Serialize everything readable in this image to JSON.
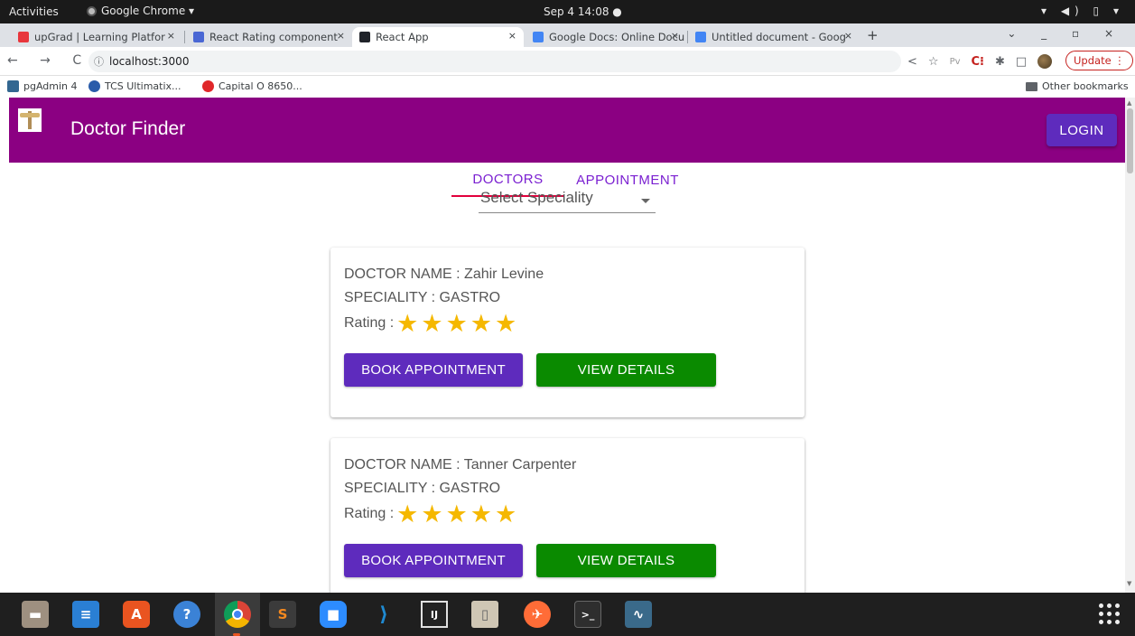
{
  "system": {
    "activities": "Activities",
    "app_name": "Google Chrome ▾",
    "clock": "Sep 4  14:08  ●",
    "tray": "▾ ◀) ▯ ▾"
  },
  "browser": {
    "tabs": [
      {
        "label": "upGrad | Learning Platfor",
        "color": "#e8363c"
      },
      {
        "label": "React Rating component",
        "color": "#4a67d4"
      },
      {
        "label": "React App",
        "color": "#20232a"
      },
      {
        "label": "Google Docs: Online Docu",
        "color": "#4285f4"
      },
      {
        "label": "Untitled document - Goog",
        "color": "#4285f4"
      }
    ],
    "tab_close": "×",
    "new_tab": "+",
    "window_controls": "⌄ _ ▫ ×",
    "nav_buttons": "← → C",
    "url": "localhost:3000",
    "update_label": "Update ⋮",
    "bookmarks": [
      {
        "label": "pgAdmin 4",
        "color": "#336791"
      },
      {
        "label": "TCS Ultimatix...",
        "color": "#2a5caa"
      },
      {
        "label": "Capital O 8650...",
        "color": "#e0272a"
      }
    ],
    "other_bookmarks": "Other bookmarks"
  },
  "app": {
    "title": "Doctor Finder",
    "login_label": "LOGIN",
    "tabs": [
      "DOCTORS",
      "APPOINTMENT"
    ],
    "select_placeholder": "Select Speciality",
    "doctors": [
      {
        "name_line": "DOCTOR NAME : Zahir Levine",
        "speciality_line": "SPECIALITY : GASTRO",
        "rating_label": "Rating :",
        "rating": 5,
        "book_label": "BOOK APPOINTMENT",
        "view_label": "VIEW DETAILS"
      },
      {
        "name_line": "DOCTOR NAME : Tanner Carpenter",
        "speciality_line": "SPECIALITY : GASTRO",
        "rating_label": "Rating :",
        "rating": 5,
        "book_label": "BOOK APPOINTMENT",
        "view_label": "VIEW DETAILS"
      }
    ]
  },
  "colors": {
    "header": "#8b0082",
    "primary_button": "#5e2bbd",
    "details_button": "#0a8a00",
    "star": "#f5b800",
    "tab_text": "#7a1fd1",
    "tab_indicator": "#e2003c"
  },
  "dock": {
    "apps": [
      {
        "name": "files-icon",
        "glyph": "▬",
        "color": "#9e9080"
      },
      {
        "name": "writer-icon",
        "glyph": "≡",
        "color": "#2a7fd4"
      },
      {
        "name": "software-icon",
        "glyph": "A",
        "color": "#e95420"
      },
      {
        "name": "help-icon",
        "glyph": "?",
        "color": "#3b82d6"
      },
      {
        "name": "chrome-icon",
        "glyph": "◉",
        "color": "#db4437"
      },
      {
        "name": "sublime-icon",
        "glyph": "S",
        "color": "#f5891f"
      },
      {
        "name": "zoom-icon",
        "glyph": "■",
        "color": "#2d8cff"
      },
      {
        "name": "vscode-icon",
        "glyph": "⟩",
        "color": "#1f8ad2"
      },
      {
        "name": "intellij-icon",
        "glyph": "IJ",
        "color": "#222222"
      },
      {
        "name": "archive-icon",
        "glyph": "▯",
        "color": "#cfc6b4"
      },
      {
        "name": "postman-icon",
        "glyph": "✈",
        "color": "#ff6c37"
      },
      {
        "name": "terminal-icon",
        "glyph": ">_",
        "color": "#2e2e2e"
      },
      {
        "name": "mysql-workbench-icon",
        "glyph": "∿",
        "color": "#3a6a8a"
      }
    ]
  }
}
